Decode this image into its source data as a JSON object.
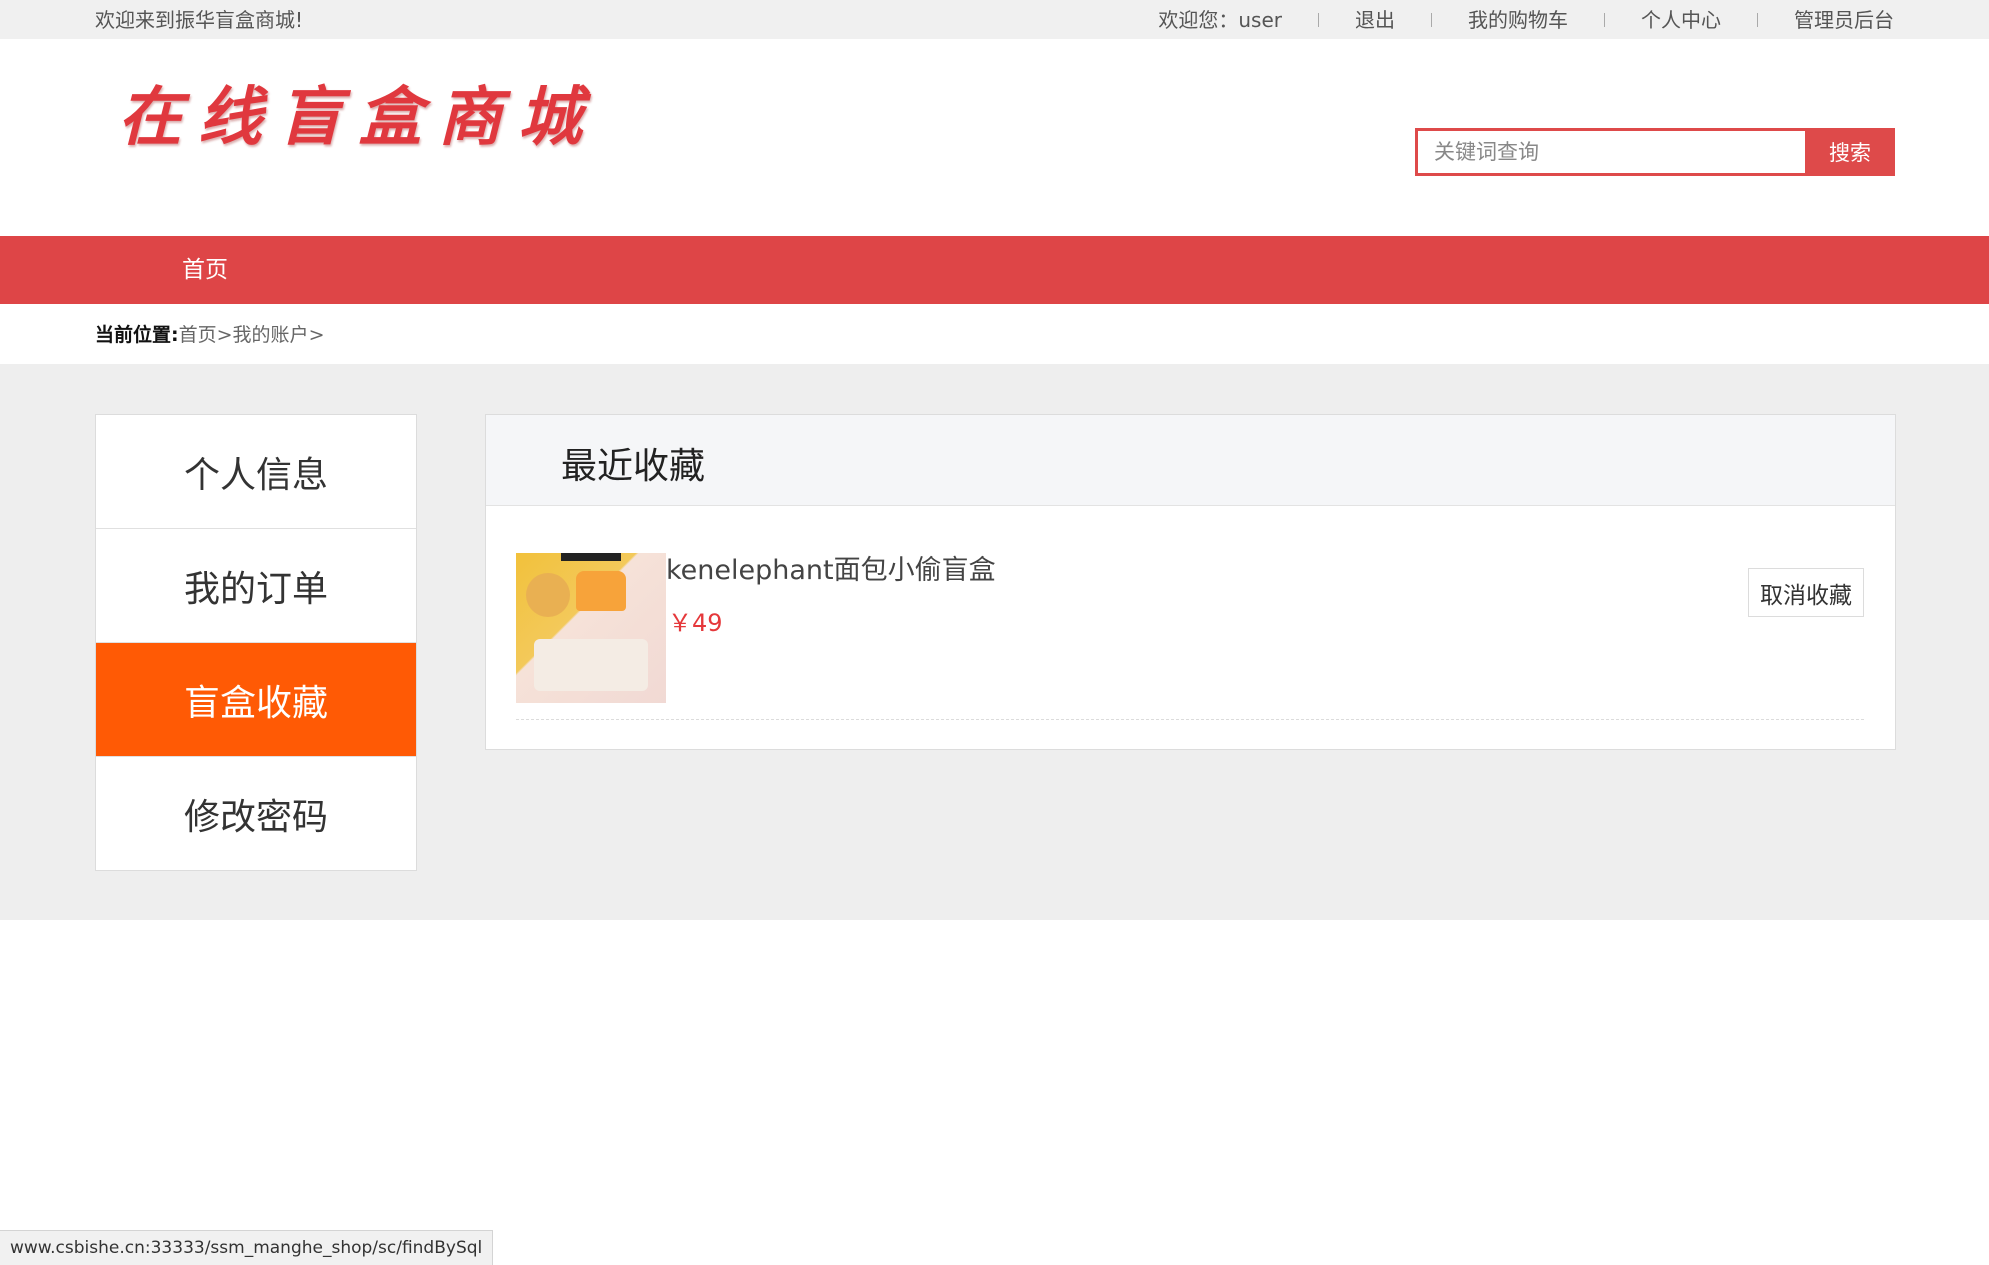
{
  "topbar": {
    "welcome": "欢迎来到振华盲盒商城!",
    "greeting": "欢迎您：user",
    "logout": "退出",
    "cart": "我的购物车",
    "profile": "个人中心",
    "admin": "管理员后台"
  },
  "header": {
    "logo_text": "在线盲盒商城",
    "search_placeholder": "关键词查询",
    "search_button": "搜索"
  },
  "nav": {
    "home": "首页"
  },
  "breadcrumb": {
    "label": "当前位置:",
    "home": "首页",
    "sep1": ">",
    "account": "我的账户",
    "sep2": ">"
  },
  "sidebar": {
    "items": [
      {
        "label": "个人信息"
      },
      {
        "label": "我的订单"
      },
      {
        "label": "盲盒收藏"
      },
      {
        "label": "修改密码"
      }
    ],
    "active_index": 2,
    "active_color": "#ff5a05"
  },
  "favorites": {
    "title": "最近收藏",
    "items": [
      {
        "name": "kenelephant面包小偷盲盒",
        "price": "￥49",
        "cancel_label": "取消收藏"
      }
    ]
  },
  "status_bar": {
    "url": "www.csbishe.cn:33333/ssm_manghe_shop/sc/findBySql"
  },
  "colors": {
    "brand_red": "#de4547",
    "price_red": "#e5383b"
  }
}
